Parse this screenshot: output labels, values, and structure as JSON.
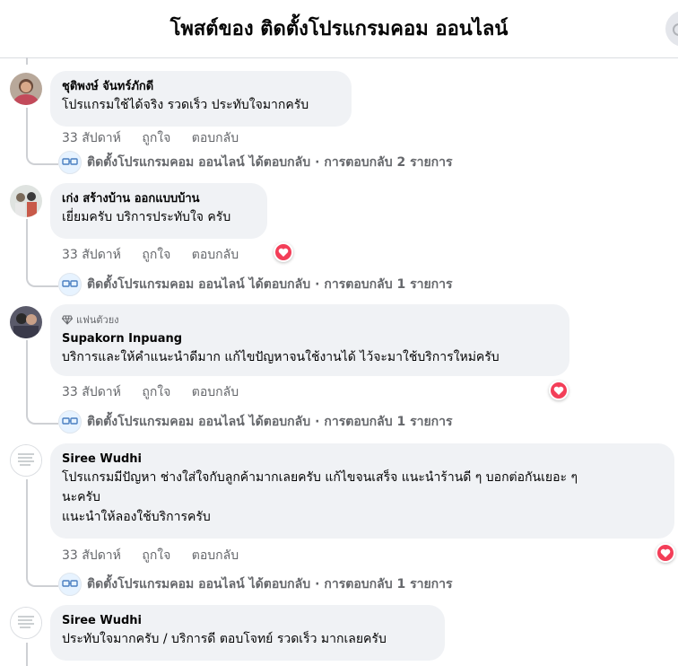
{
  "header": {
    "title": "โพสต์ของ ติดตั้งโปรแกรมคอม ออนไลน์"
  },
  "labels": {
    "like": "ถูกใจ",
    "reply": "ตอบกลับ",
    "separator": "·"
  },
  "comments": [
    {
      "author": "ชุติพงษ์ จันทร์ภักดี",
      "text": "โปรแกรมใช้ได้จริง รวดเร็ว ประทับใจมากครับ",
      "time": "33 สัปดาห์",
      "reply_author": "ติดตั้งโปรแกรมคอม ออนไลน์ ได้ตอบกลับ",
      "reply_count": "การตอบกลับ 2 รายการ"
    },
    {
      "author": "เก่ง สร้างบ้าน ออกแบบบ้าน",
      "text": "เยี่ยมครับ บริการประทับใจ ครับ",
      "time": "33 สัปดาห์",
      "reaction": "love",
      "reply_author": "ติดตั้งโปรแกรมคอม ออนไลน์ ได้ตอบกลับ",
      "reply_count": "การตอบกลับ 1 รายการ"
    },
    {
      "badge": "แฟนตัวยง",
      "author": "Supakorn Inpuang",
      "text": "บริการและให้คำแนะนำดีมาก แก้ไขปัญหาจนใช้งานได้ ไว้จะมาใช้บริการใหม่ครับ",
      "time": "33 สัปดาห์",
      "reaction": "love",
      "reply_author": "ติดตั้งโปรแกรมคอม ออนไลน์ ได้ตอบกลับ",
      "reply_count": "การตอบกลับ 1 รายการ"
    },
    {
      "author": "Siree Wudhi",
      "text_lines": [
        "โปรแกรมมีปัญหา ช่างใส่ใจกับลูกค้ามากเลยครับ แก้ไขจนเสร็จ แนะนำร้านดี ๆ บอกต่อกันเยอะ ๆ",
        "นะครับ",
        "แนะนำให้ลองใช้บริการครับ"
      ],
      "time": "33 สัปดาห์",
      "reaction": "love",
      "reply_author": "ติดตั้งโปรแกรมคอม ออนไลน์ ได้ตอบกลับ",
      "reply_count": "การตอบกลับ 1 รายการ"
    },
    {
      "author": "Siree Wudhi",
      "text": "ประทับใจมากครับ / บริการดี ตอบโจทย์ รวดเร็ว มากเลยครับ"
    }
  ],
  "colors": {
    "bubble": "#f0f2f5",
    "muted": "#65676b",
    "love": "#f33e58",
    "line": "#ced0d4"
  }
}
